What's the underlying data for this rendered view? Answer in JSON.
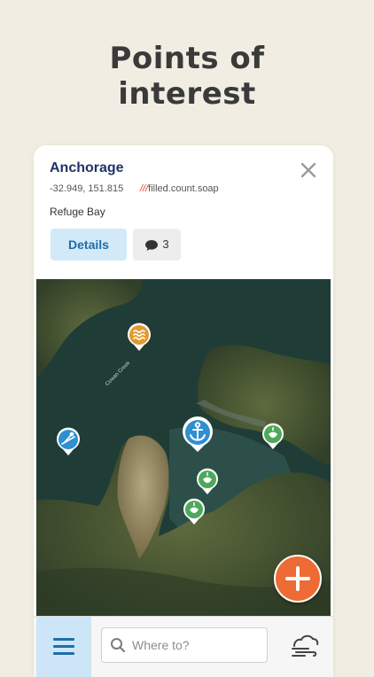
{
  "headline": {
    "line1": "Points of",
    "line2": "interest"
  },
  "poi": {
    "title": "Anchorage",
    "coordinates": "-32.949, 151.815",
    "what3words_prefix": "///",
    "what3words": "filled.count.soap",
    "location": "Refuge Bay",
    "details_label": "Details",
    "comment_count": "3"
  },
  "map": {
    "creek_label": "Cowan Creek",
    "markers": [
      {
        "icon": "waves-icon",
        "color": "#e39a2d"
      },
      {
        "icon": "ramp-icon",
        "color": "#2f8fd1"
      },
      {
        "icon": "anchor-icon",
        "color": "#2f8fd1"
      },
      {
        "icon": "mooring-icon",
        "color": "#4fa85a"
      }
    ]
  },
  "bottom_bar": {
    "search_placeholder": "Where to?",
    "accent": "#1d6ea8"
  },
  "colors": {
    "fab": "#ef6b35",
    "details_bg": "#d2e9f8"
  }
}
